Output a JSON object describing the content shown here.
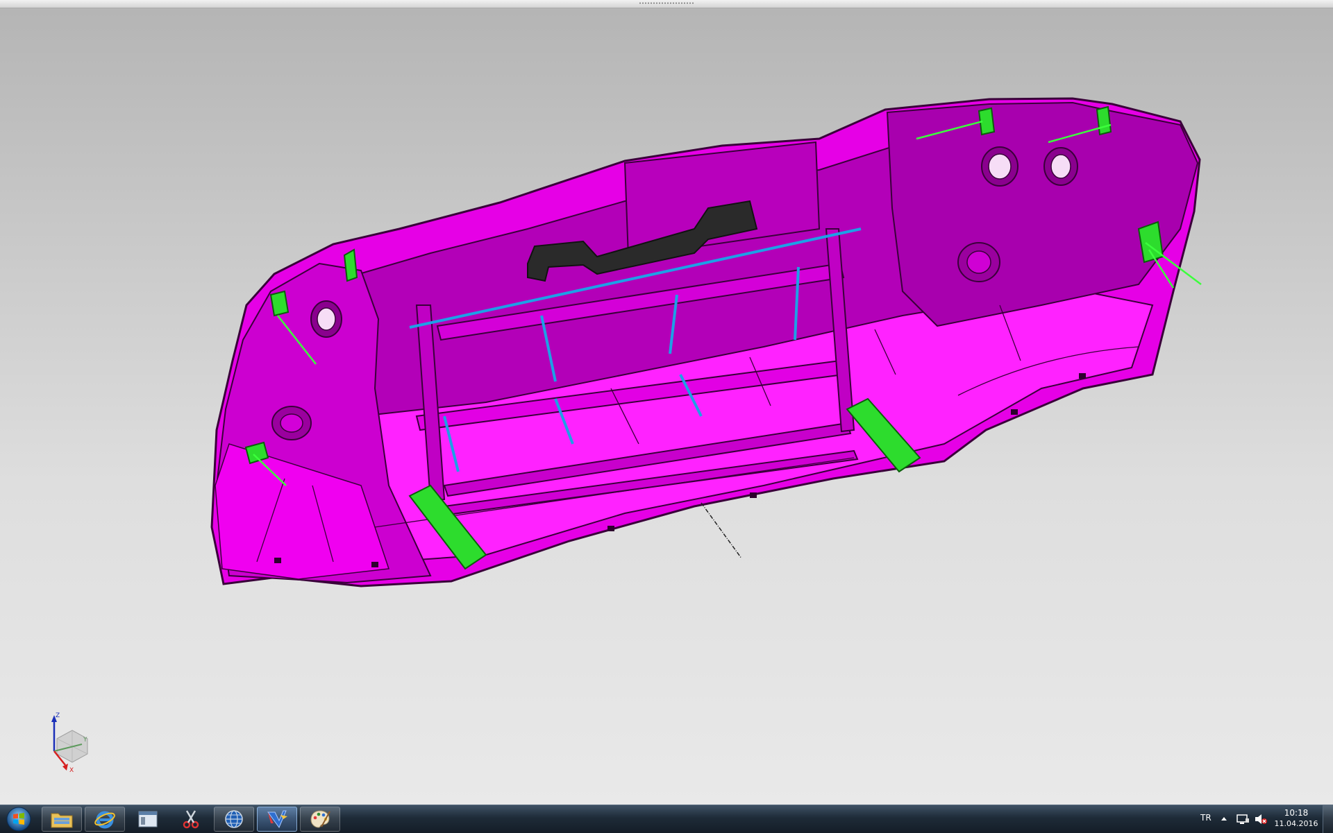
{
  "viewer": {
    "background_top": "#b4b4b4",
    "background_bottom": "#e9e9e9",
    "model_color": "#ee00ee",
    "model_shade": "#b000b5",
    "highlight_green": "#3cff3c",
    "accent_cyan": "#1ea0e6"
  },
  "compass": {
    "z_label": "Z",
    "y_label": "Y",
    "x_label": "X"
  },
  "taskbar": {
    "items": [
      {
        "name": "start-button",
        "icon": "windows-orb-icon"
      },
      {
        "name": "explorer-button",
        "icon": "folder-icon"
      },
      {
        "name": "internet-explorer-button",
        "icon": "ie-icon"
      },
      {
        "name": "window-app-button",
        "icon": "window-icon"
      },
      {
        "name": "snipping-tool-button",
        "icon": "scissors-icon"
      },
      {
        "name": "globe-app-button",
        "icon": "globe-icon"
      },
      {
        "name": "catia-button",
        "icon": "catia-icon"
      },
      {
        "name": "paint-button",
        "icon": "palette-icon"
      }
    ],
    "language": "TR",
    "time": "10:18",
    "date": "11.04.2016"
  }
}
